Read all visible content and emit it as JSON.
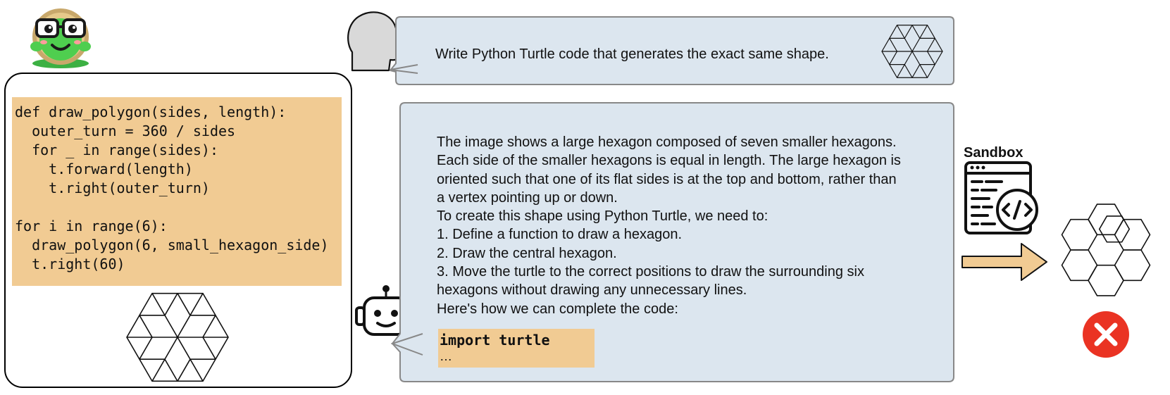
{
  "left_panel": {
    "code_lines": [
      "def draw_polygon(sides, length):",
      "  outer_turn = 360 / sides",
      "  for _ in range(sides):",
      "    t.forward(length)",
      "    t.right(outer_turn)",
      "",
      "for i in range(6):",
      "  draw_polygon(6, small_hexagon_side)",
      "  t.right(60)"
    ]
  },
  "user_prompt": {
    "text": "Write Python Turtle code that generates the exact same shape."
  },
  "bot_response": {
    "lines": [
      "The image shows a large hexagon composed of seven smaller hexagons.",
      "Each side of the smaller hexagons is equal in length. The large hexagon is",
      "oriented such that one of its flat sides is at the top and bottom, rather than",
      "a vertex pointing up or down.",
      "To create this shape using Python Turtle, we need to:",
      "1. Define a function to draw a hexagon.",
      "2. Draw the central hexagon.",
      "3. Move the turtle to the correct positions to draw the surrounding six",
      "hexagons without drawing any unnecessary lines.",
      "Here's how we can complete the code:"
    ],
    "code_line": "import turtle",
    "code_ellipsis": "…"
  },
  "sandbox": {
    "label": "Sandbox"
  },
  "colors": {
    "code_bg": "#f1cb93",
    "bubble_fill": "#dce6ef",
    "bubble_stroke": "#888888",
    "fail_red": "#ea3323",
    "turtle_green": "#4fce4f",
    "arrow_fill": "#f1cb93"
  },
  "icons": {
    "mascot": "turtle-mascot-icon",
    "human": "human-head-icon",
    "robot": "robot-icon",
    "sandbox": "code-window-icon",
    "arrow": "right-arrow-icon",
    "fail": "close-circle-icon"
  }
}
